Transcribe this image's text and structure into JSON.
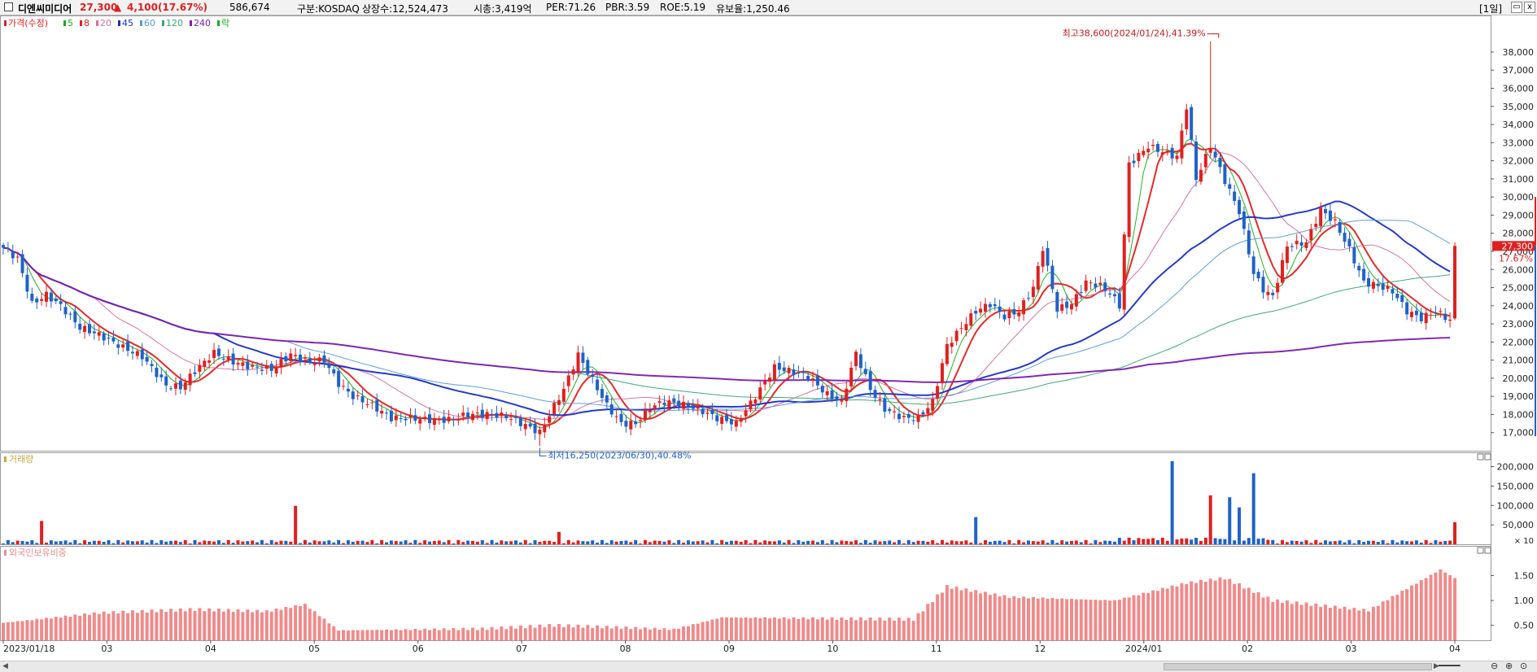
{
  "header": {
    "name": "디엔씨미디어",
    "price": "27,300",
    "change_arrow": "▲",
    "change": "4,100",
    "change_pct": "(17.67%)",
    "volume": "586,674",
    "market": "구분:KOSDAQ",
    "listed": "상장수:12,524,473",
    "mcap": "시총:3,419억",
    "per": "PER:71.26",
    "pbr": "PBR:3.59",
    "roe": "ROE:5.19",
    "reserve": "유보율:1,250.46",
    "period": "[1일]",
    "btn_min": "▭",
    "btn_close": "x"
  },
  "legend": {
    "price": "가격(수정)",
    "items": [
      {
        "label": "5",
        "color": "#1eaa1e"
      },
      {
        "label": "8",
        "color": "#e02020"
      },
      {
        "label": "20",
        "color": "#d26ea6"
      },
      {
        "label": "45",
        "color": "#1a2fc0"
      },
      {
        "label": "60",
        "color": "#5a9ad6"
      },
      {
        "label": "120",
        "color": "#3aa372"
      },
      {
        "label": "240",
        "color": "#7a1fb0"
      },
      {
        "label": "락",
        "color": "#1eaa1e"
      }
    ]
  },
  "colors": {
    "up": "#e02020",
    "down": "#1f62c7",
    "ratio": "#f08a8a",
    "axis": "#555555"
  },
  "annotations": {
    "high": "최고38,600(2024/01/24),41.39%",
    "low": "최저16,250(2023/06/30),40.48%",
    "last_price": "27,300",
    "last_pct": "17.67%"
  },
  "chart_data": [
    {
      "type": "candlestick",
      "title": "가격(수정)",
      "x_labels": [
        "2023/01/18",
        "03",
        "04",
        "05",
        "06",
        "07",
        "08",
        "09",
        "10",
        "11",
        "12",
        "2024/01",
        "02",
        "03",
        "04"
      ],
      "y_ticks": [
        "17,000",
        "18,000",
        "19,000",
        "20,000",
        "21,000",
        "22,000",
        "23,000",
        "24,000",
        "25,000",
        "26,000",
        "27,000",
        "28,000",
        "29,000",
        "30,000",
        "31,000",
        "32,000",
        "33,000",
        "34,000",
        "35,000",
        "36,000",
        "37,000",
        "38,000"
      ],
      "ylim": [
        16000,
        39300
      ],
      "anchors": [
        [
          0,
          27200
        ],
        [
          3,
          26600
        ],
        [
          6,
          24100
        ],
        [
          9,
          24600
        ],
        [
          12,
          24000
        ],
        [
          16,
          22800
        ],
        [
          20,
          22400
        ],
        [
          25,
          21700
        ],
        [
          29,
          21200
        ],
        [
          34,
          19600
        ],
        [
          37,
          19500
        ],
        [
          40,
          20400
        ],
        [
          44,
          21400
        ],
        [
          48,
          20900
        ],
        [
          52,
          20600
        ],
        [
          56,
          20500
        ],
        [
          60,
          21300
        ],
        [
          64,
          20900
        ],
        [
          67,
          21000
        ],
        [
          70,
          19700
        ],
        [
          73,
          19000
        ],
        [
          77,
          18500
        ],
        [
          81,
          17800
        ],
        [
          85,
          17800
        ],
        [
          89,
          17700
        ],
        [
          93,
          17700
        ],
        [
          97,
          18000
        ],
        [
          101,
          18000
        ],
        [
          105,
          17900
        ],
        [
          109,
          17400
        ],
        [
          112,
          17000
        ],
        [
          114,
          18000
        ],
        [
          117,
          19400
        ],
        [
          120,
          21300
        ],
        [
          123,
          19900
        ],
        [
          126,
          18500
        ],
        [
          129,
          17500
        ],
        [
          132,
          17500
        ],
        [
          135,
          18400
        ],
        [
          138,
          18700
        ],
        [
          141,
          18600
        ],
        [
          145,
          18300
        ],
        [
          149,
          17800
        ],
        [
          153,
          17500
        ],
        [
          157,
          19000
        ],
        [
          161,
          20600
        ],
        [
          164,
          20400
        ],
        [
          168,
          20100
        ],
        [
          172,
          19100
        ],
        [
          175,
          18700
        ],
        [
          178,
          21400
        ],
        [
          181,
          19400
        ],
        [
          184,
          18300
        ],
        [
          188,
          17800
        ],
        [
          191,
          17800
        ],
        [
          194,
          18700
        ],
        [
          197,
          21800
        ],
        [
          200,
          22800
        ],
        [
          203,
          23700
        ],
        [
          206,
          24100
        ],
        [
          209,
          23400
        ],
        [
          212,
          23700
        ],
        [
          215,
          25000
        ],
        [
          217,
          27200
        ],
        [
          220,
          23800
        ],
        [
          223,
          24100
        ],
        [
          226,
          25300
        ],
        [
          229,
          25100
        ],
        [
          231,
          24700
        ],
        [
          233,
          24000
        ],
        [
          235,
          31800
        ],
        [
          239,
          32800
        ],
        [
          242,
          32500
        ],
        [
          245,
          32200
        ],
        [
          247,
          35000
        ],
        [
          249,
          31000
        ],
        [
          252,
          32800
        ],
        [
          255,
          30900
        ],
        [
          258,
          29200
        ],
        [
          261,
          25800
        ],
        [
          263,
          24900
        ],
        [
          265,
          24500
        ],
        [
          268,
          27300
        ],
        [
          272,
          27500
        ],
        [
          275,
          29300
        ],
        [
          278,
          28600
        ],
        [
          281,
          27100
        ],
        [
          284,
          25300
        ],
        [
          287,
          25100
        ],
        [
          290,
          24800
        ],
        [
          293,
          23700
        ],
        [
          296,
          23300
        ],
        [
          299,
          23700
        ],
        [
          302,
          23200
        ]
      ],
      "last": {
        "open": 23300,
        "close": 27300,
        "high": 27500,
        "low": 23200
      },
      "high_point": {
        "index": 252,
        "value": 38600,
        "date": "2024/01/24"
      },
      "low_point": {
        "index": 112,
        "value": 16250,
        "date": "2023/06/30"
      },
      "ma_windows": [
        5,
        8,
        20,
        45,
        60,
        120,
        240
      ]
    },
    {
      "type": "bar",
      "title": "거래량",
      "y_ticks": [
        "50,000",
        "100,000",
        "150,000",
        "200,000"
      ],
      "ylim": [
        0,
        220000
      ],
      "unit_note": "× 10",
      "spikes": [
        [
          8,
          60000
        ],
        [
          61,
          99000
        ],
        [
          116,
          32000
        ],
        [
          203,
          70000
        ],
        [
          244,
          214000
        ],
        [
          252,
          126000
        ],
        [
          256,
          121000
        ],
        [
          258,
          95000
        ],
        [
          261,
          183000
        ],
        [
          303,
          57000
        ]
      ]
    },
    {
      "type": "bar",
      "title": "외국인보유비중",
      "y_ticks": [
        "0.50",
        "1.00",
        "1.50"
      ],
      "ylim": [
        0.2,
        1.9
      ]
    }
  ],
  "zoom": {
    "in": "⊕",
    "out": "⊖",
    "fit": "⊙"
  },
  "scroll": {
    "left": "◀",
    "right": "▶"
  }
}
